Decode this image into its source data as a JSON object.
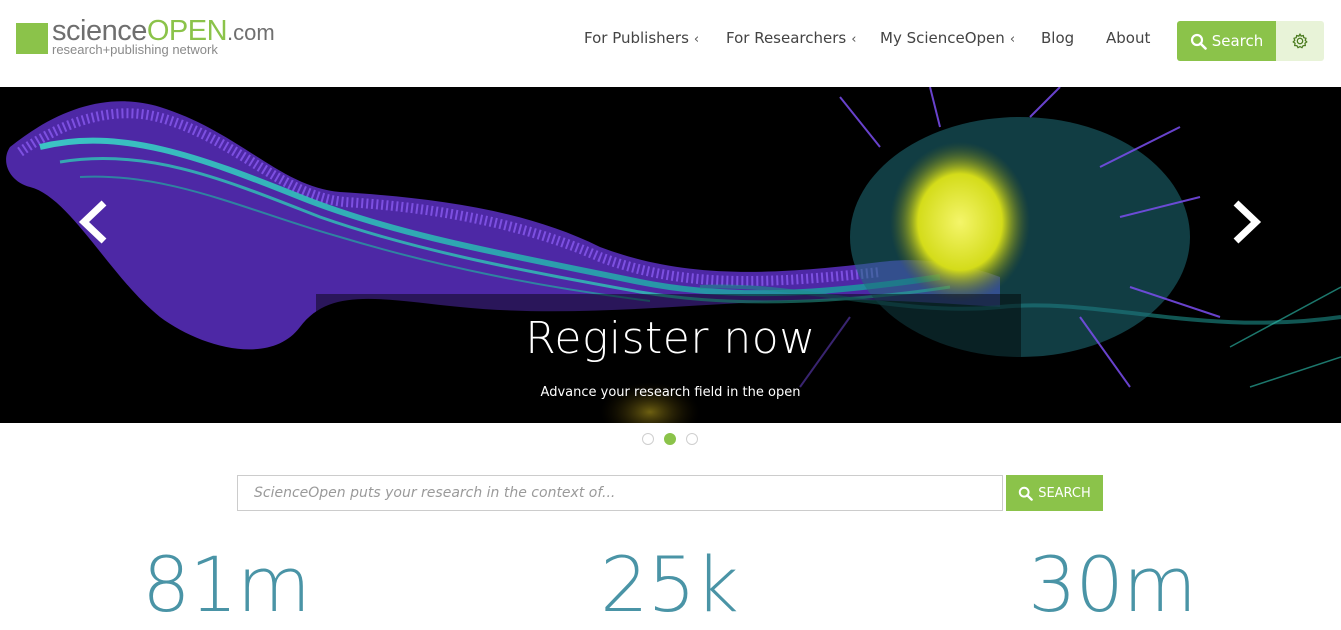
{
  "brand": {
    "name_part1": "science",
    "name_part2": "OPEN",
    "name_suffix": ".com",
    "tagline": "research+publishing network",
    "accent_color": "#8bc34a",
    "stat_color": "#4a94a6"
  },
  "nav": {
    "items": [
      {
        "label": "For Publishers",
        "has_submenu": true
      },
      {
        "label": "For Researchers",
        "has_submenu": true
      },
      {
        "label": "My ScienceOpen",
        "has_submenu": true
      },
      {
        "label": "Blog",
        "has_submenu": false
      },
      {
        "label": "About",
        "has_submenu": false
      }
    ],
    "submenu_chevron": "‹",
    "search_label": "Search",
    "search_icon": "search-icon",
    "settings_icon": "gear-icon"
  },
  "hero": {
    "title": "Register now",
    "subtitle": "Advance your research field in the open",
    "prev_icon": "chevron-left-icon",
    "next_icon": "chevron-right-icon",
    "slides_count": 3,
    "active_slide": 2
  },
  "search": {
    "placeholder": "ScienceOpen puts your research in the context of...",
    "value": "",
    "button_label": "SEARCH"
  },
  "stats": [
    {
      "value": "81m"
    },
    {
      "value": "25k"
    },
    {
      "value": "30m"
    }
  ]
}
